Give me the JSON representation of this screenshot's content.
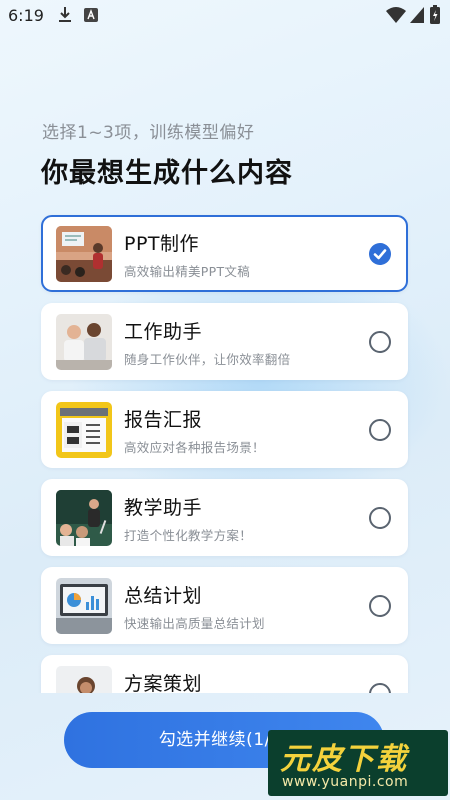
{
  "status_bar": {
    "time": "6:19",
    "icons": [
      "download-icon",
      "app-a-icon",
      "wifi-icon",
      "signal-icon",
      "battery-icon"
    ]
  },
  "header": {
    "subtitle": "选择1~3项，训练模型偏好",
    "title": "你最想生成什么内容"
  },
  "options": [
    {
      "title": "PPT制作",
      "desc": "高效输出精美PPT文稿",
      "selected": true,
      "thumb": "presentation-photo"
    },
    {
      "title": "工作助手",
      "desc": "随身工作伙伴，让你效率翻倍",
      "selected": false,
      "thumb": "coworkers-photo"
    },
    {
      "title": "报告汇报",
      "desc": "高效应对各种报告场景！",
      "selected": false,
      "thumb": "calendar-checklist-image"
    },
    {
      "title": "教学助手",
      "desc": "打造个性化教学方案！",
      "selected": false,
      "thumb": "classroom-photo"
    },
    {
      "title": "总结计划",
      "desc": "快速输出高质量总结计划",
      "selected": false,
      "thumb": "laptop-charts-photo"
    },
    {
      "title": "方案策划",
      "desc": "",
      "selected": false,
      "thumb": "woman-portrait-photo"
    }
  ],
  "cta": {
    "label": "勾选并继续(1/3)"
  },
  "watermark": {
    "brand": "元皮下载",
    "url": "www.yuanpi.com"
  },
  "colors": {
    "accent": "#2f6fd8",
    "card_bg": "#ffffff",
    "subtitle": "#8a8f96"
  }
}
